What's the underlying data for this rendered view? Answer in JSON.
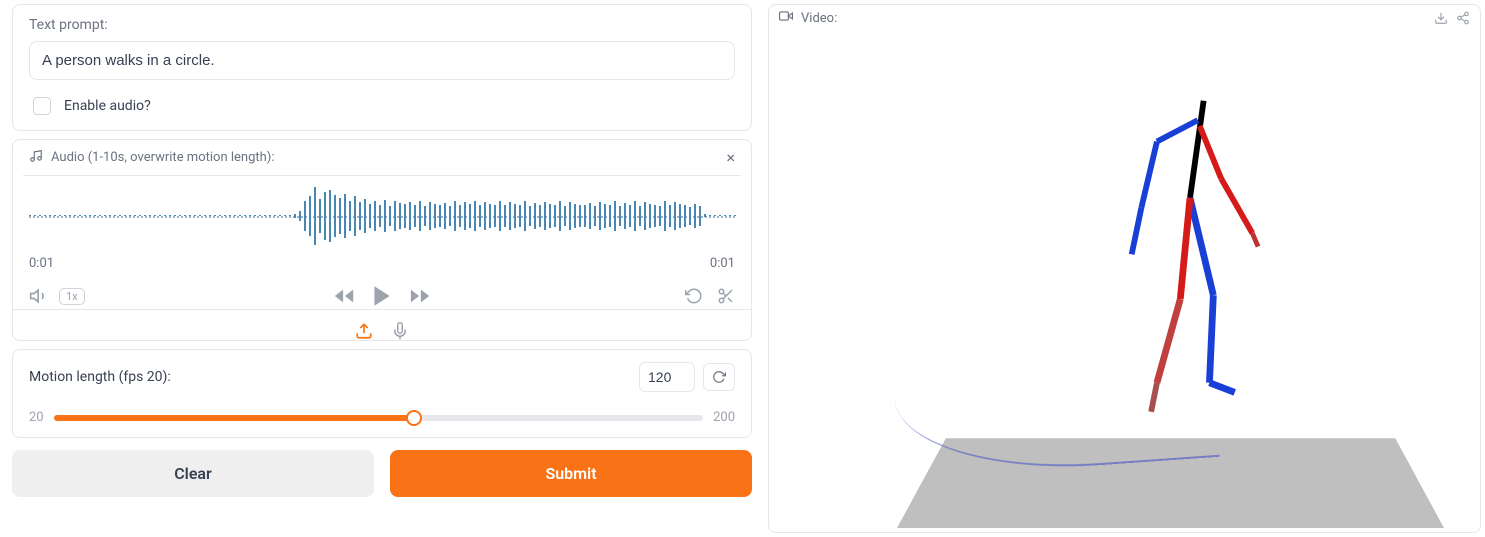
{
  "prompt": {
    "label": "Text prompt:",
    "value": "A person walks in a circle.",
    "audio_checkbox": "Enable audio?"
  },
  "audio": {
    "header": "Audio (1-10s, overwrite motion length):",
    "time_start": "0:01",
    "time_end": "0:01",
    "speed": "1x",
    "bars": [
      0,
      0,
      0,
      0,
      0,
      0,
      0,
      0,
      0,
      0,
      0,
      0,
      0,
      0,
      0,
      0,
      0,
      0,
      0,
      0,
      0,
      0,
      0,
      0,
      0,
      0,
      0,
      0,
      0,
      0,
      0,
      0,
      0,
      0,
      0,
      0,
      0,
      0,
      0,
      0,
      0,
      0,
      0,
      0,
      0,
      0,
      0,
      0,
      0,
      0,
      0,
      0,
      0,
      4,
      10,
      30,
      40,
      58,
      34,
      48,
      52,
      42,
      36,
      44,
      30,
      40,
      28,
      34,
      24,
      30,
      22,
      32,
      20,
      30,
      26,
      24,
      28,
      22,
      30,
      20,
      28,
      24,
      22,
      26,
      20,
      30,
      22,
      28,
      24,
      30,
      22,
      28,
      24,
      22,
      30,
      22,
      28,
      24,
      22,
      30,
      20,
      26,
      22,
      28,
      24,
      22,
      30,
      20,
      28,
      24,
      22,
      22,
      26,
      20,
      28,
      24,
      22,
      30,
      20,
      26,
      22,
      30,
      20,
      28,
      24,
      22,
      20,
      30,
      22,
      28,
      24,
      22,
      18,
      24,
      20,
      3,
      0,
      0,
      0,
      0,
      0,
      0
    ]
  },
  "motion": {
    "label": "Motion length (fps 20):",
    "value": "120",
    "min": "20",
    "max": "200",
    "fill_pct": 55.5
  },
  "buttons": {
    "clear": "Clear",
    "submit": "Submit"
  },
  "video": {
    "label": "Video:"
  }
}
